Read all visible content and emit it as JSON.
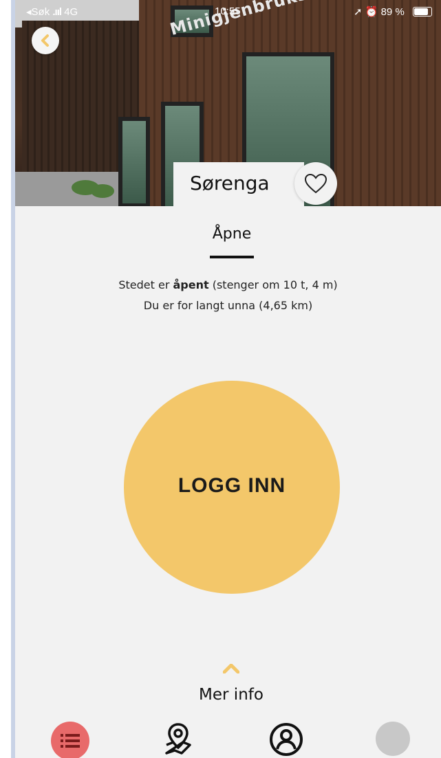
{
  "status_bar": {
    "carrier": "◂Søk",
    "network": "4G",
    "time": "10:55",
    "battery_percent": "89 %",
    "battery_level": 0.89
  },
  "hero": {
    "sign_text": "Minigjenbruksstasjon",
    "back_icon": "chevron-left-icon"
  },
  "place": {
    "name": "Sørenga",
    "favorite_icon": "heart-outline-icon"
  },
  "tab": {
    "label": "Åpne"
  },
  "status": {
    "prefix": "Stedet er ",
    "open_word": "åpent",
    "suffix": " (stenger om 10 t, 4 m)",
    "distance": "Du er for langt unna (4,65 km)"
  },
  "login": {
    "label": "LOGG INN"
  },
  "more_info": {
    "label": "Mer info"
  },
  "nav": {
    "items": [
      "list-icon",
      "map-pin-icon",
      "profile-icon",
      "gray-circle-icon"
    ]
  },
  "colors": {
    "accent": "#f3c76a",
    "nav_active": "#e86a6a",
    "background": "#f2f2f2"
  }
}
